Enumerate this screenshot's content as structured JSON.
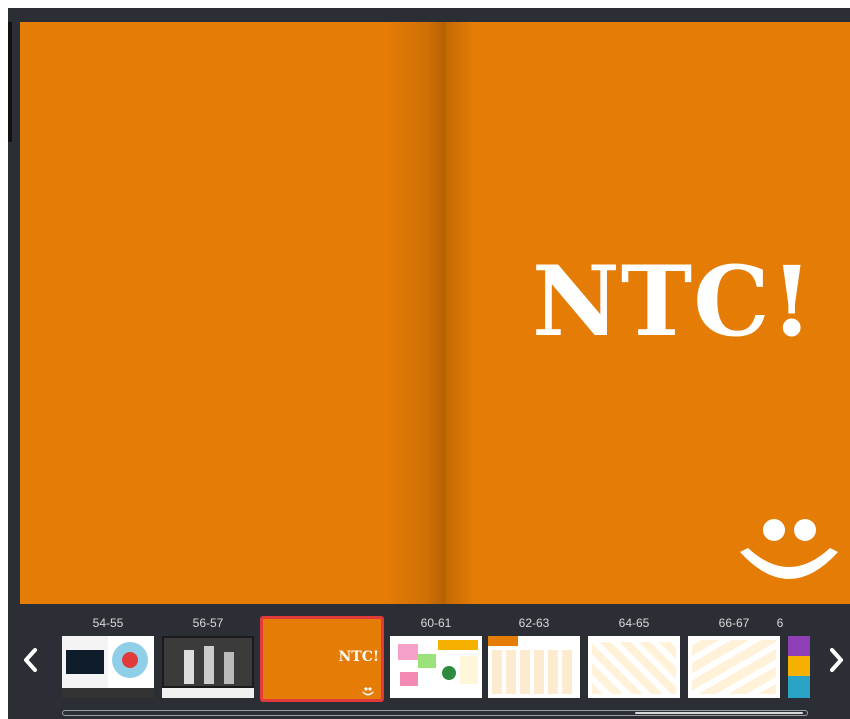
{
  "spread": {
    "right_page_title": "NTC!"
  },
  "thumbnails": {
    "labels": [
      "54-55",
      "56-57",
      "60-61",
      "62-63",
      "64-65",
      "66-67",
      "6"
    ],
    "active_thumb_text": "NTC!"
  },
  "navigation": {
    "prev_icon": "chevron-left-icon",
    "next_icon": "chevron-right-icon"
  },
  "colors": {
    "page_orange": "#e57c05",
    "viewer_bg": "#2b2f35",
    "active_border": "#e03a3a"
  }
}
